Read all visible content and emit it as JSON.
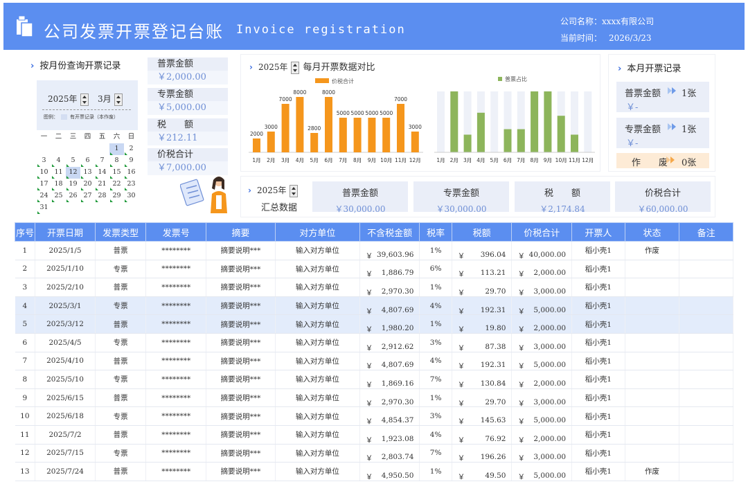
{
  "header": {
    "title": "公司发票开票登记台账",
    "subtitle": "Invoice registration",
    "company_label": "公司名称：",
    "company_value": "xxxx有限公司",
    "date_label": "当前时间：",
    "date_value": "2026/3/23"
  },
  "query": {
    "title": "按月份查询开票记录",
    "year": "2025年",
    "month": "3月",
    "legend": "图例：",
    "legend_text": "有开票记录（本作废）",
    "weekdays": [
      "一",
      "二",
      "三",
      "四",
      "五",
      "六",
      "日"
    ],
    "weeks": [
      [
        "",
        "",
        "",
        "",
        "",
        "1",
        "2"
      ],
      [
        "3",
        "4",
        "5",
        "6",
        "7",
        "8",
        "9"
      ],
      [
        "10",
        "11",
        "12",
        "13",
        "14",
        "15",
        "16"
      ],
      [
        "17",
        "18",
        "19",
        "20",
        "21",
        "22",
        "23"
      ],
      [
        "24",
        "25",
        "26",
        "27",
        "28",
        "29",
        "30"
      ],
      [
        "31",
        "",
        "",
        "",
        "",
        "",
        ""
      ]
    ]
  },
  "left_summary": [
    {
      "label": "普票金额",
      "value": "￥2,000.00"
    },
    {
      "label": "专票金额",
      "value": "￥5,000.00"
    },
    {
      "label": "税　　额",
      "value": "￥212.11"
    },
    {
      "label": "价税合计",
      "value": "￥7,000.00"
    }
  ],
  "chart_header": {
    "year": "2025年",
    "title": "每月开票数据对比"
  },
  "chart_data": [
    {
      "type": "bar",
      "categories": [
        "1月",
        "2月",
        "3月",
        "4月",
        "5月",
        "6月",
        "7月",
        "8月",
        "9月",
        "10月",
        "11月",
        "12月"
      ],
      "series": [
        {
          "name": "价税合计",
          "values": [
            2000,
            3000,
            7000,
            8000,
            2800,
            8000,
            5000,
            5000,
            5000,
            5000,
            7000,
            3000
          ],
          "color": "#f5961c"
        }
      ],
      "data_labels": [
        "2000",
        "3000",
        "7000",
        "8000",
        "2800",
        "8000",
        "5000",
        "5000",
        "5000",
        "5000",
        "7000",
        "3000"
      ]
    },
    {
      "type": "bar",
      "categories": [
        "1月",
        "2月",
        "3月",
        "4月",
        "5月",
        "6月",
        "7月",
        "8月",
        "9月",
        "10月",
        "11月",
        "12月"
      ],
      "series": [
        {
          "name": "普票占比",
          "values": [
            0,
            1.0,
            0.29,
            0.65,
            0,
            0.38,
            0.38,
            1.0,
            1.0,
            0.6,
            0.29,
            0
          ],
          "color": "#8db55b"
        }
      ],
      "background_color": "#eef1f8"
    }
  ],
  "month_record": {
    "title": "本月开票记录",
    "rows": [
      {
        "label": "普票金额",
        "count": "1张",
        "value": "￥-"
      },
      {
        "label": "专票金额",
        "count": "1张",
        "value": "￥-"
      },
      {
        "label": "作　　废",
        "count": "0张"
      }
    ]
  },
  "totals": {
    "year": "2025年",
    "label": "汇总数据",
    "cards": [
      {
        "label": "普票金额",
        "value": "￥30,000.00"
      },
      {
        "label": "专票金额",
        "value": "￥30,000.00"
      },
      {
        "label": "税　　额",
        "value": "￥2,174.84"
      },
      {
        "label": "价税合计",
        "value": "￥60,000.00"
      }
    ]
  },
  "table": {
    "headers": [
      "序号",
      "开票日期",
      "发票类型",
      "发票号",
      "摘要",
      "对方单位",
      "不含税金额",
      "税率",
      "税额",
      "价税合计",
      "开票人",
      "状态",
      "备注"
    ],
    "currency": "￥",
    "rows": [
      {
        "no": "1",
        "date": "2025/1/5",
        "type": "普票",
        "num": "********",
        "sum": "摘要说明***",
        "party": "输入对方单位",
        "net": "39,603.96",
        "rate": "1%",
        "tax": "396.04",
        "total": "40,000.00",
        "issuer": "稻小壳1",
        "status": "作废",
        "note": "",
        "hi": false
      },
      {
        "no": "2",
        "date": "2025/1/10",
        "type": "专票",
        "num": "********",
        "sum": "摘要说明***",
        "party": "输入对方单位",
        "net": "1,886.79",
        "rate": "6%",
        "tax": "113.21",
        "total": "2,000.00",
        "issuer": "稻小壳1",
        "status": "",
        "note": "",
        "hi": false
      },
      {
        "no": "3",
        "date": "2025/2/10",
        "type": "普票",
        "num": "********",
        "sum": "摘要说明***",
        "party": "输入对方单位",
        "net": "2,970.30",
        "rate": "1%",
        "tax": "29.70",
        "total": "3,000.00",
        "issuer": "稻小壳1",
        "status": "",
        "note": "",
        "hi": false
      },
      {
        "no": "4",
        "date": "2025/3/1",
        "type": "专票",
        "num": "********",
        "sum": "摘要说明***",
        "party": "输入对方单位",
        "net": "4,807.69",
        "rate": "4%",
        "tax": "192.31",
        "total": "5,000.00",
        "issuer": "稻小壳1",
        "status": "",
        "note": "",
        "hi": true
      },
      {
        "no": "5",
        "date": "2025/3/12",
        "type": "普票",
        "num": "********",
        "sum": "摘要说明***",
        "party": "输入对方单位",
        "net": "1,980.20",
        "rate": "1%",
        "tax": "19.80",
        "total": "2,000.00",
        "issuer": "稻小壳1",
        "status": "",
        "note": "",
        "hi": true
      },
      {
        "no": "6",
        "date": "2025/4/5",
        "type": "专票",
        "num": "********",
        "sum": "摘要说明***",
        "party": "输入对方单位",
        "net": "2,912.62",
        "rate": "3%",
        "tax": "87.38",
        "total": "3,000.00",
        "issuer": "稻小壳1",
        "status": "",
        "note": "",
        "hi": false
      },
      {
        "no": "7",
        "date": "2025/4/10",
        "type": "普票",
        "num": "********",
        "sum": "摘要说明***",
        "party": "输入对方单位",
        "net": "4,807.69",
        "rate": "4%",
        "tax": "192.31",
        "total": "5,000.00",
        "issuer": "稻小壳1",
        "status": "",
        "note": "",
        "hi": false
      },
      {
        "no": "8",
        "date": "2025/5/10",
        "type": "专票",
        "num": "********",
        "sum": "摘要说明***",
        "party": "输入对方单位",
        "net": "1,869.16",
        "rate": "7%",
        "tax": "130.84",
        "total": "2,000.00",
        "issuer": "稻小壳1",
        "status": "",
        "note": "",
        "hi": false
      },
      {
        "no": "9",
        "date": "2025/6/15",
        "type": "普票",
        "num": "********",
        "sum": "摘要说明***",
        "party": "输入对方单位",
        "net": "2,970.30",
        "rate": "1%",
        "tax": "29.70",
        "total": "3,000.00",
        "issuer": "稻小壳1",
        "status": "",
        "note": "",
        "hi": false
      },
      {
        "no": "10",
        "date": "2025/6/18",
        "type": "专票",
        "num": "********",
        "sum": "摘要说明***",
        "party": "输入对方单位",
        "net": "4,854.37",
        "rate": "3%",
        "tax": "145.63",
        "total": "5,000.00",
        "issuer": "稻小壳1",
        "status": "",
        "note": "",
        "hi": false
      },
      {
        "no": "11",
        "date": "2025/7/2",
        "type": "普票",
        "num": "********",
        "sum": "摘要说明***",
        "party": "输入对方单位",
        "net": "1,923.08",
        "rate": "4%",
        "tax": "76.92",
        "total": "2,000.00",
        "issuer": "稻小壳1",
        "status": "",
        "note": "",
        "hi": false
      },
      {
        "no": "12",
        "date": "2025/7/15",
        "type": "专票",
        "num": "********",
        "sum": "摘要说明***",
        "party": "输入对方单位",
        "net": "2,803.74",
        "rate": "7%",
        "tax": "196.26",
        "total": "3,000.00",
        "issuer": "稻小壳1",
        "status": "",
        "note": "",
        "hi": false
      },
      {
        "no": "13",
        "date": "2025/7/24",
        "type": "普票",
        "num": "********",
        "sum": "摘要说明***",
        "party": "输入对方单位",
        "net": "4,950.50",
        "rate": "1%",
        "tax": "49.50",
        "total": "5,000.00",
        "issuer": "稻小壳1",
        "status": "作废",
        "note": "",
        "hi": false
      }
    ]
  },
  "colors": {
    "accent": "#5b8ef0",
    "orange": "#f5961c",
    "green": "#8db55b",
    "value_blue": "#6f8fd6"
  }
}
